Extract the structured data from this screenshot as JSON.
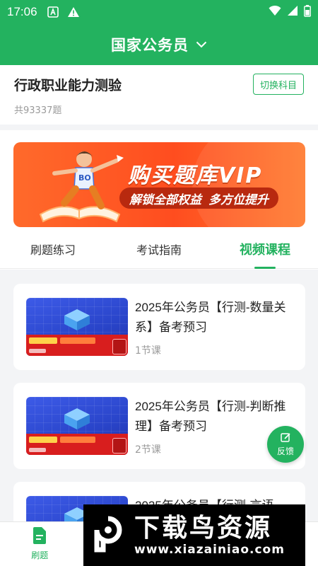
{
  "status_bar": {
    "time": "17:06",
    "icons": [
      "font-a-icon",
      "alert-icon",
      "wifi-icon",
      "signal-icon",
      "battery-icon"
    ]
  },
  "header": {
    "title": "国家公务员",
    "dropdown_icon": "chevron-down-icon"
  },
  "subject": {
    "title": "行政职业能力测验",
    "count": "共93337题",
    "switch_label": "切换科目"
  },
  "banner": {
    "headline": "购买题库VIP",
    "sub_1": "解锁全部权益",
    "sub_2": "多方位提升"
  },
  "tabs": [
    {
      "label": "刷题练习",
      "active": false
    },
    {
      "label": "考试指南",
      "active": false
    },
    {
      "label": "视频课程",
      "active": true
    }
  ],
  "courses": [
    {
      "title": "2025年公务员【行测-数量关系】备考预习",
      "lessons": "1节课"
    },
    {
      "title": "2025年公务员【行测-判断推理】备考预习",
      "lessons": "2节课"
    },
    {
      "title": "2025年公务员【行测-言语",
      "lessons": ""
    }
  ],
  "feedback": {
    "label": "反馈"
  },
  "bottom_nav": [
    {
      "label": "刷题",
      "icon": "document-icon",
      "active": true
    },
    {
      "label": "",
      "icon": "",
      "active": false
    },
    {
      "label": "",
      "icon": "",
      "active": false
    },
    {
      "label": "",
      "icon": "",
      "active": false
    }
  ],
  "watermark": {
    "big": "下载鸟资源",
    "small": "www.xiazainiao.com"
  },
  "colors": {
    "primary": "#23b25f",
    "banner": "#ff5a22",
    "text": "#222222",
    "muted": "#9a9a9a"
  }
}
